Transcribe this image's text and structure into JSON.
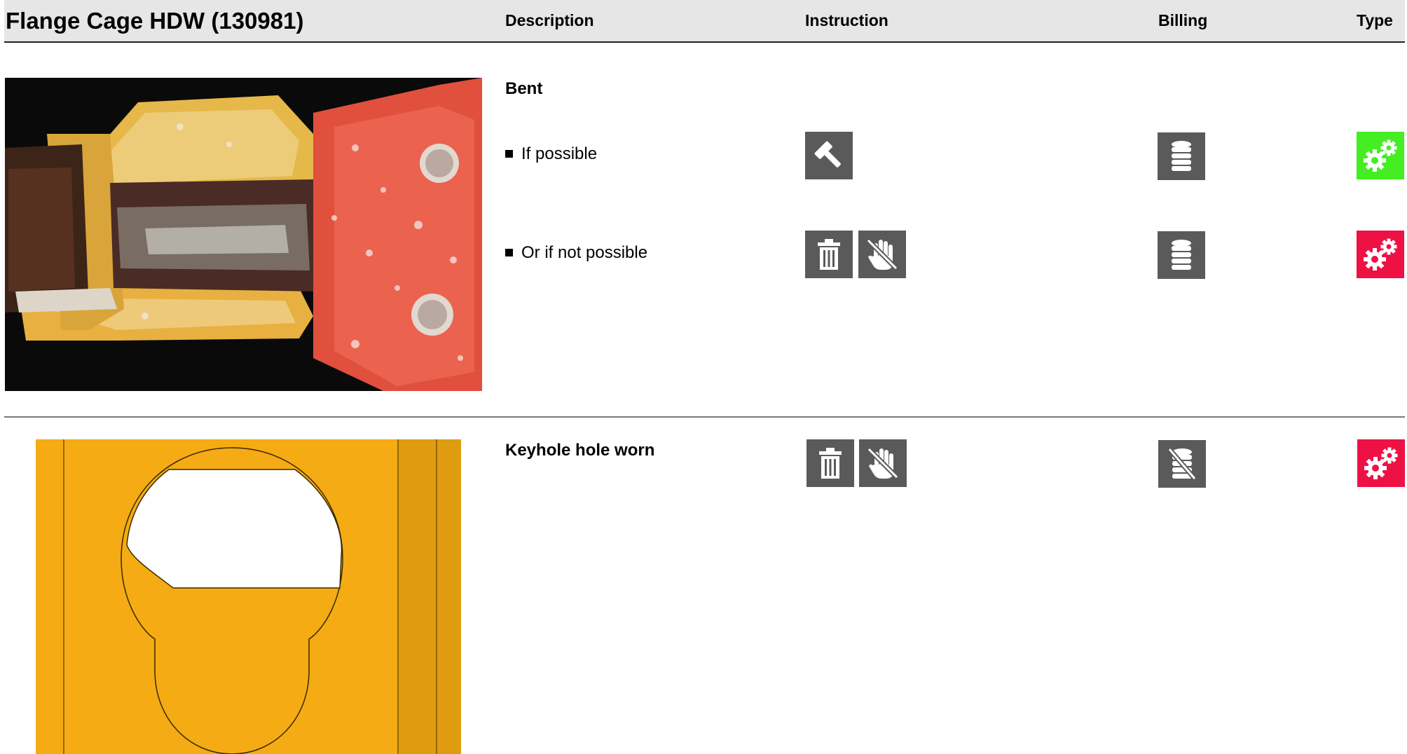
{
  "header": {
    "title": "Flange Cage HDW (130981)",
    "columns": {
      "description": "Description",
      "instruction": "Instruction",
      "billing": "Billing",
      "type": "Type"
    }
  },
  "defects": [
    {
      "title": "Bent",
      "image": "photo of bent flange cage (rusty red/yellow painted steel)",
      "options": [
        {
          "label": "If possible",
          "instruction_icons": [
            "hammer-icon"
          ],
          "billing_icon": "coin-stack-icon",
          "type_icon": "gears-icon",
          "type_color": "#44ee22"
        },
        {
          "label": "Or if not possible",
          "instruction_icons": [
            "trash-icon",
            "no-hand-icon"
          ],
          "billing_icon": "coin-stack-icon",
          "type_icon": "gears-icon",
          "type_color": "#ee1144"
        }
      ]
    },
    {
      "title": "Keyhole hole worn",
      "image": "illustration of worn keyhole in yellow plate",
      "instruction_icons": [
        "trash-icon",
        "no-hand-icon"
      ],
      "billing_icon": "no-coin-stack-icon",
      "type_icon": "gears-icon",
      "type_color": "#ee1144"
    }
  ]
}
